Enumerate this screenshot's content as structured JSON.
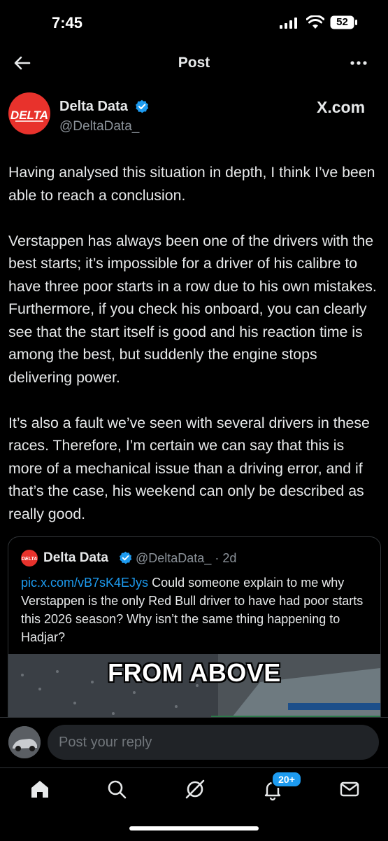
{
  "status_bar": {
    "time": "7:45",
    "battery": "52"
  },
  "header": {
    "title": "Post"
  },
  "author": {
    "name": "Delta Data",
    "handle": "@DeltaData_",
    "source_label": "X.com",
    "logo_text": "DELTA"
  },
  "post": {
    "paragraphs": [
      "Having analysed this situation in depth, I think I’ve been able to reach a conclusion.",
      "Verstappen has always been one of the drivers with the best starts; it’s impossible for a driver of his calibre to have three poor starts in a row due to his own mistakes. Furthermore, if you check his onboard, you can clearly see that the start itself is good and his reaction time is among the best, but suddenly the engine stops delivering power.",
      "It’s also a fault we’ve seen with several drivers in these races. Therefore, I’m certain we can say that this is more of a mechanical issue than a driving error, and if that’s the case, his weekend can only be described as really good."
    ]
  },
  "quote": {
    "name": "Delta Data",
    "handle_time": "@DeltaData_ · 2d",
    "link": "pic.x.com/vB7sK4EJys",
    "text": " Could someone explain to me why Verstappen is the only Red Bull driver to have had poor starts this 2026 season? Why isn’t the same thing happening to Hadjar?",
    "media_caption": "FROM ABOVE"
  },
  "reply": {
    "placeholder": "Post your reply"
  },
  "tabbar": {
    "notifications_badge": "20+"
  },
  "colors": {
    "accent": "#1d9bf0",
    "brand_red": "#e8322c",
    "background": "#000000"
  },
  "icons": [
    "back-arrow-icon",
    "more-icon",
    "verified-icon",
    "home-icon",
    "search-icon",
    "grok-icon",
    "bell-icon",
    "mail-icon"
  ]
}
